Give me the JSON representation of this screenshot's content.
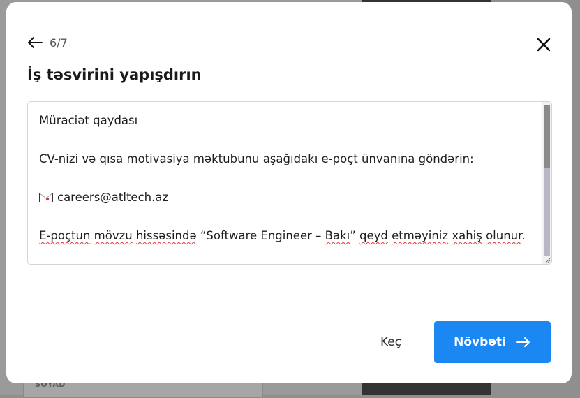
{
  "background": {
    "field_label": "SOYAD"
  },
  "modal": {
    "step": "6/7",
    "title": "İş təsvirini yapışdırın",
    "textarea": {
      "lines": {
        "heading": "Müraciət qaydası",
        "instruction": "CV-nizi və qısa motivasiya məktubunu aşağıdakı e-poçt ünvanına göndərin:",
        "email": "careers@atltech.az",
        "note_w1": "E-poçtun",
        "note_w2": "mövzu",
        "note_w3": "hissəsində",
        "note_quote": "“Software Engineer –",
        "note_w4": "Bakı",
        "note_quote_end": "”",
        "note_w5": "qeyd",
        "note_w6": "etməyiniz",
        "note_w7": "xahiş",
        "note_w8": "olunur",
        "note_end": "."
      }
    },
    "skip_label": "Keç",
    "next_label": "Növbəti"
  },
  "colors": {
    "primary": "#1a87f3",
    "spellcheck": "#e03a3a"
  },
  "icons": {
    "back": "arrow-left-icon",
    "close": "close-icon",
    "email": "envelope-icon",
    "next": "arrow-right-icon"
  }
}
